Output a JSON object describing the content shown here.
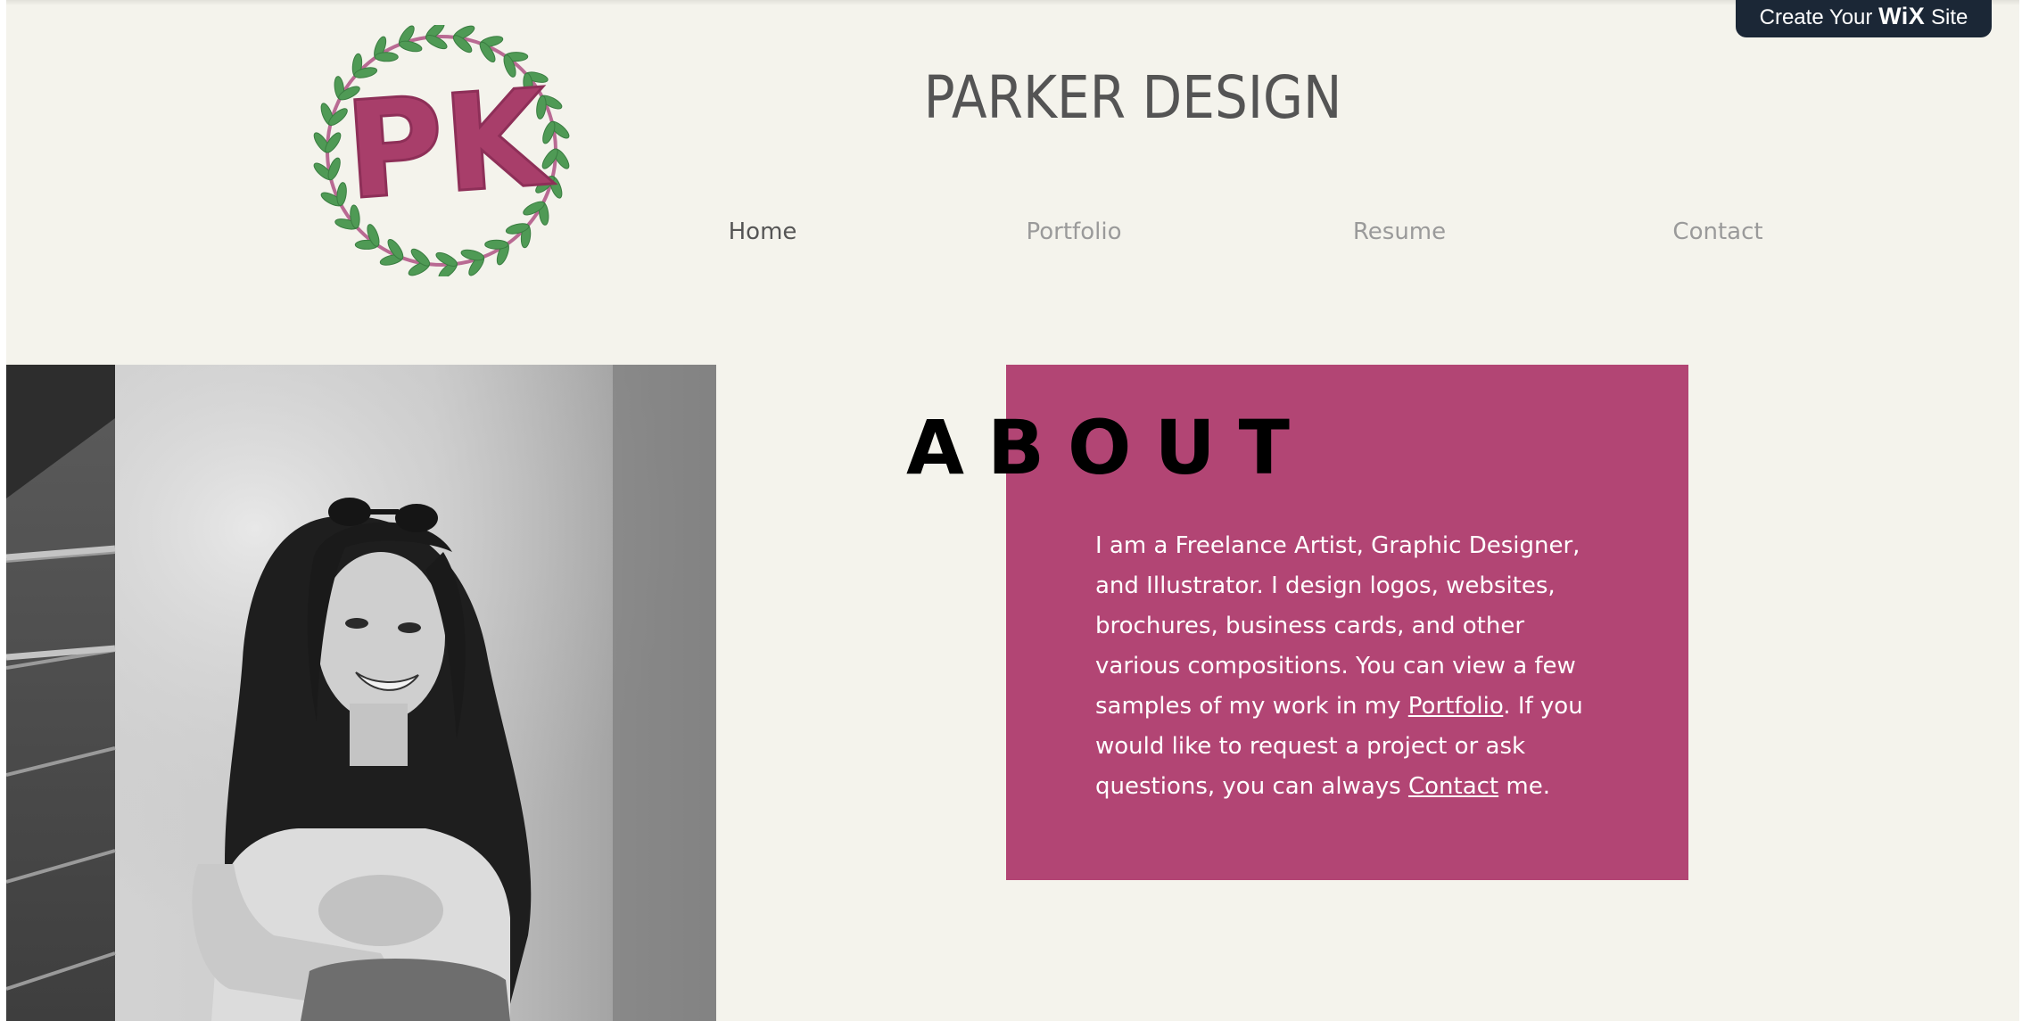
{
  "banner": {
    "prefix": "Create Your",
    "brand": "WiX",
    "suffix": "Site"
  },
  "logo": {
    "text": "PK"
  },
  "site": {
    "title": "PARKER DESIGN"
  },
  "nav": {
    "items": [
      "Home",
      "Portfolio",
      "Resume",
      "Contact"
    ],
    "active": "Home"
  },
  "about": {
    "heading": "ABOUT",
    "body_before_portfolio": "I am a Freelance Artist, Graphic Designer, and Illustrator. I design logos, websites, brochures, business cards, and other various compositions. You can view a few samples of my work in my ",
    "portfolio_link": "Portfolio",
    "body_middle": ". If you would like to request a project or ask questions, you can always ",
    "contact_link": "Contact",
    "body_end": " me."
  },
  "colors": {
    "background": "#f4f3ec",
    "accent_pink": "#b24574",
    "wreath_green": "#4f9a55",
    "banner_navy": "#1b2736",
    "title_gray": "#545454",
    "nav_gray": "#9a9a9a"
  }
}
